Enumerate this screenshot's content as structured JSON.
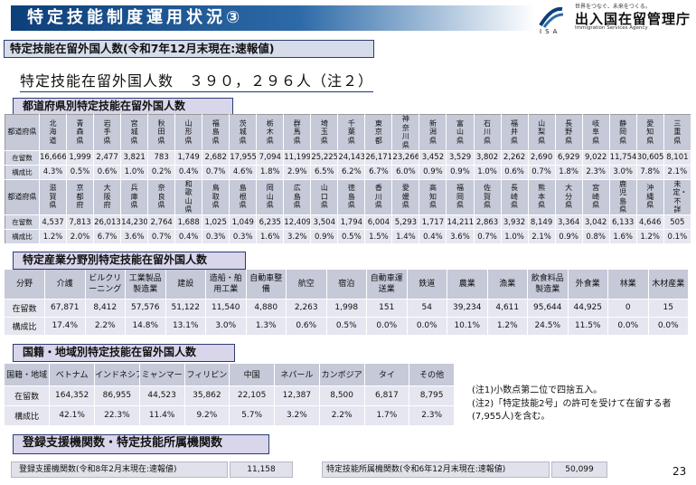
{
  "header": {
    "title": "特定技能制度運用状況③",
    "logo_tagline": "世界をつなぐ、未来をつくる。",
    "logo_name": "出入国在留管理庁",
    "logo_english": "Immigration Services Agency",
    "logo_abbr": "ISA"
  },
  "summary": {
    "heading": "特定技能在留外国人数(令和7年12月末現在:速報値)",
    "total_text": "特定技能在留外国人数　３９０，２９６人（注２）"
  },
  "prefecture_section": {
    "heading": "都道府県別特定技能在留外国人数",
    "label_prefecture": "都道府県",
    "label_count": "在留数",
    "label_ratio": "構成比",
    "rows": [
      {
        "names": [
          "北海道",
          "青森県",
          "岩手県",
          "宮城県",
          "秋田県",
          "山形県",
          "福島県",
          "茨城県",
          "栃木県",
          "群馬県",
          "埼玉県",
          "千葉県",
          "東京都",
          "神奈川県",
          "新潟県",
          "富山県",
          "石川県",
          "福井県",
          "山梨県",
          "長野県",
          "岐阜県",
          "静岡県",
          "愛知県",
          "三重県"
        ],
        "counts": [
          "16,666",
          "1,999",
          "2,477",
          "3,821",
          "783",
          "1,749",
          "2,682",
          "17,955",
          "7,094",
          "11,199",
          "25,225",
          "24,143",
          "26,171",
          "23,266",
          "3,452",
          "3,529",
          "3,802",
          "2,262",
          "2,690",
          "6,929",
          "9,022",
          "11,754",
          "30,605",
          "8,101"
        ],
        "ratios": [
          "4.3%",
          "0.5%",
          "0.6%",
          "1.0%",
          "0.2%",
          "0.4%",
          "0.7%",
          "4.6%",
          "1.8%",
          "2.9%",
          "6.5%",
          "6.2%",
          "6.7%",
          "6.0%",
          "0.9%",
          "0.9%",
          "1.0%",
          "0.6%",
          "0.7%",
          "1.8%",
          "2.3%",
          "3.0%",
          "7.8%",
          "2.1%"
        ]
      },
      {
        "names": [
          "滋賀県",
          "京都府",
          "大阪府",
          "兵庫県",
          "奈良県",
          "和歌山県",
          "鳥取県",
          "島根県",
          "岡山県",
          "広島県",
          "山口県",
          "徳島県",
          "香川県",
          "愛媛県",
          "高知県",
          "福岡県",
          "佐賀県",
          "長崎県",
          "熊本県",
          "大分県",
          "宮崎県",
          "鹿児島県",
          "沖縄県",
          "未定・不詳"
        ],
        "counts": [
          "4,537",
          "7,813",
          "26,013",
          "14,230",
          "2,764",
          "1,688",
          "1,025",
          "1,049",
          "6,235",
          "12,409",
          "3,504",
          "1,794",
          "6,004",
          "5,293",
          "1,717",
          "14,211",
          "2,863",
          "3,932",
          "8,149",
          "3,364",
          "3,042",
          "6,133",
          "4,646",
          "505"
        ],
        "ratios": [
          "1.2%",
          "2.0%",
          "6.7%",
          "3.6%",
          "0.7%",
          "0.4%",
          "0.3%",
          "0.3%",
          "1.6%",
          "3.2%",
          "0.9%",
          "0.5%",
          "1.5%",
          "1.4%",
          "0.4%",
          "3.6%",
          "0.7%",
          "1.0%",
          "2.1%",
          "0.9%",
          "0.8%",
          "1.6%",
          "1.2%",
          "0.1%"
        ]
      }
    ]
  },
  "field_section": {
    "heading": "特定産業分野別特定技能在留外国人数",
    "label_field": "分野",
    "label_count": "在留数",
    "label_ratio": "構成比",
    "fields": [
      "介護",
      "ビルクリーニング",
      "工業製品製造業",
      "建設",
      "造船・舶用工業",
      "自動車整備",
      "航空",
      "宿泊",
      "自動車運送業",
      "鉄道",
      "農業",
      "漁業",
      "飲食料品製造業",
      "外食業",
      "林業",
      "木材産業"
    ],
    "counts": [
      "67,871",
      "8,412",
      "57,576",
      "51,122",
      "11,540",
      "4,880",
      "2,263",
      "1,998",
      "151",
      "54",
      "39,234",
      "4,611",
      "95,644",
      "44,925",
      "0",
      "15"
    ],
    "ratios": [
      "17.4%",
      "2.2%",
      "14.8%",
      "13.1%",
      "3.0%",
      "1.3%",
      "0.6%",
      "0.5%",
      "0.0%",
      "0.0%",
      "10.1%",
      "1.2%",
      "24.5%",
      "11.5%",
      "0.0%",
      "0.0%"
    ]
  },
  "nationality_section": {
    "heading": "国籍・地域別特定技能在留外国人数",
    "label_nat": "国籍・地域",
    "label_count": "在留数",
    "label_ratio": "構成比",
    "nations": [
      "ベトナム",
      "インドネシア",
      "ミャンマー",
      "フィリピン",
      "中国",
      "ネパール",
      "カンボジア",
      "タイ",
      "その他"
    ],
    "counts": [
      "164,352",
      "86,955",
      "44,523",
      "35,862",
      "22,105",
      "12,387",
      "8,500",
      "6,817",
      "8,795"
    ],
    "ratios": [
      "42.1%",
      "22.3%",
      "11.4%",
      "9.2%",
      "5.7%",
      "3.2%",
      "2.2%",
      "1.7%",
      "2.3%"
    ]
  },
  "notes": {
    "note1": "(注1)小数点第二位で四捨五入。",
    "note2": "(注2)「特定技能2号」の許可を受けて在留する者(7,955人)を含む。"
  },
  "registration": {
    "heading": "登録支援機関数・特定技能所属機関数",
    "support_label": "登録支援機関数(令和8年2月末現在:速報値)",
    "support_value": "11,158",
    "affiliated_label": "特定技能所属機関数(令和6年12月末現在:速報値)",
    "affiliated_value": "50,099"
  },
  "page_number": "23",
  "colors": {
    "title_blue": "#0d3f7a",
    "header_cell": "#c5c9d8",
    "value_cell": "#e5e6ef",
    "section_label": "#d9d5ea"
  }
}
